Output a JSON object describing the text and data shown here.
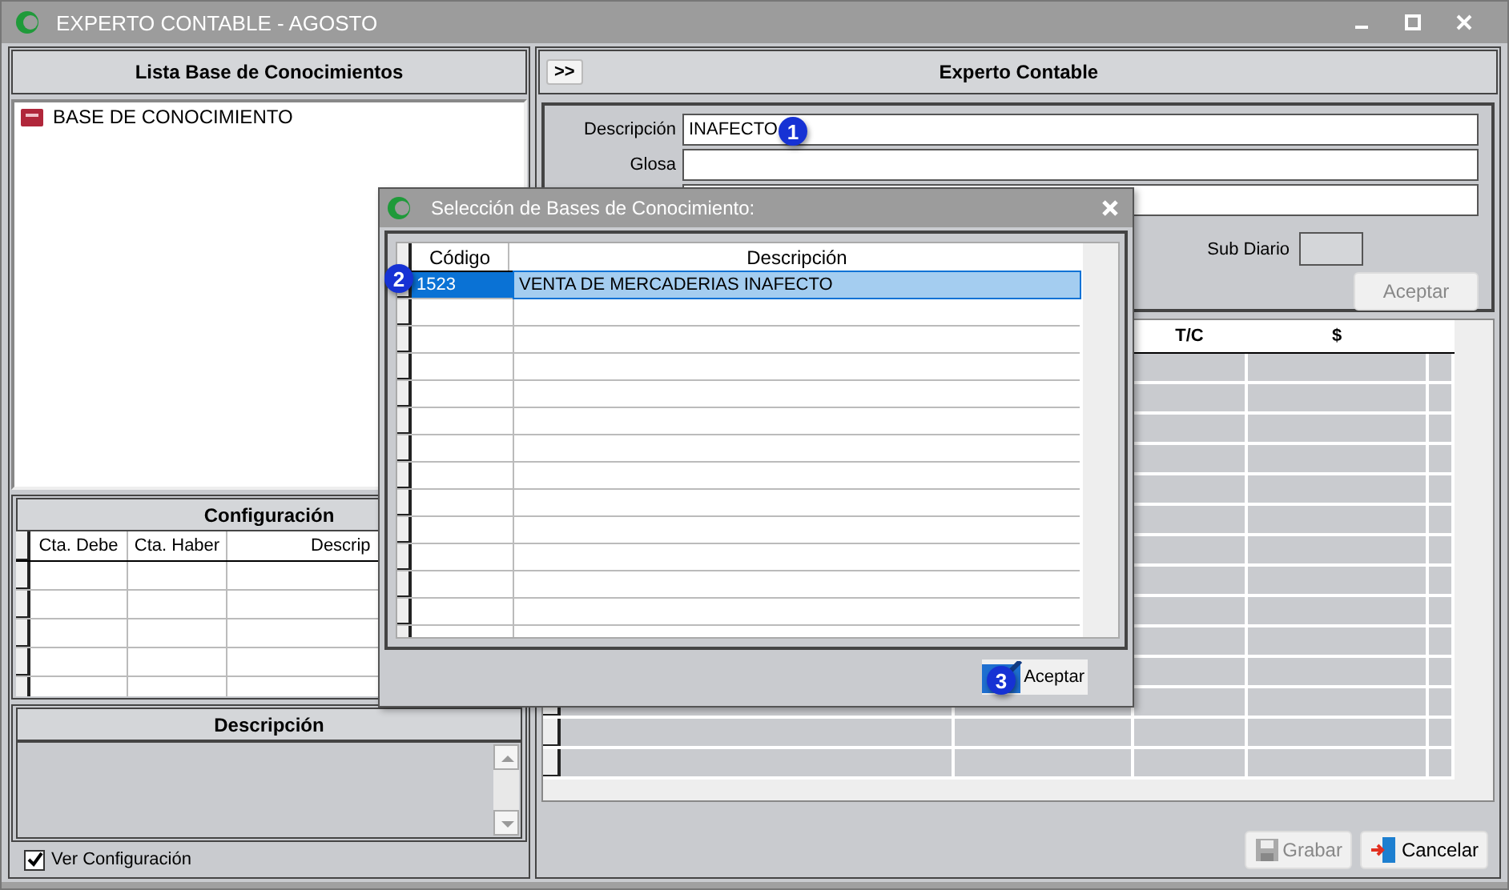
{
  "window": {
    "title": "EXPERTO CONTABLE - AGOSTO"
  },
  "left_panel": {
    "title": "Lista Base de Conocimientos",
    "tree": [
      {
        "label": "BASE DE CONOCIMIENTO"
      }
    ],
    "config": {
      "title": "Configuración",
      "columns": [
        "Cta. Debe",
        "Cta. Haber",
        "Descrip"
      ]
    },
    "description": {
      "title": "Descripción"
    },
    "show_config": {
      "label": "Ver Configuración",
      "checked": true
    }
  },
  "right_panel": {
    "toggle": ">>",
    "title": "Experto Contable",
    "form": {
      "description": {
        "label": "Descripción",
        "value": "INAFECTO"
      },
      "glosa": {
        "label": "Glosa"
      },
      "sub_diario": {
        "label": "Sub Diario"
      },
      "accept": {
        "label": "Aceptar",
        "disabled": true
      }
    },
    "grid": {
      "columns": [
        "T/C",
        "$"
      ]
    },
    "buttons": [
      {
        "label": "Grabar",
        "kind": "save",
        "disabled": true
      },
      {
        "label": "Cancelar",
        "kind": "cancel",
        "disabled": false
      }
    ]
  },
  "dialog": {
    "title": "Selección de Bases de Conocimiento:",
    "columns": [
      "Código",
      "Descripción"
    ],
    "rows": [
      {
        "code": "1523",
        "description": "VENTA DE MERCADERIAS INAFECTO",
        "selected": true
      }
    ],
    "accept": "Aceptar"
  },
  "callouts": [
    "1",
    "2",
    "3"
  ]
}
